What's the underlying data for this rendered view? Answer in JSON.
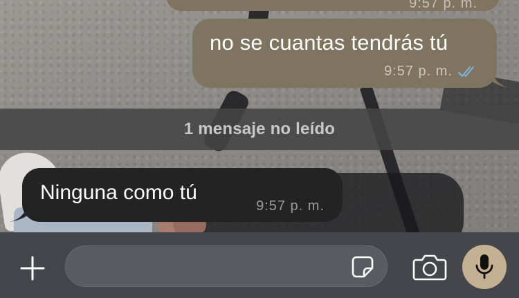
{
  "chat": {
    "previous_message": {
      "time": "9:57 p. m."
    },
    "outgoing_message": {
      "text": "no se cuantas tendrás tú",
      "time": "9:57 p. m.",
      "status_icon": "double-check-read-icon"
    },
    "unread_divider": {
      "label": "1 mensaje no leído"
    },
    "incoming_message": {
      "text": "Ninguna como tú",
      "time": "9:57 p. m."
    }
  },
  "composer": {
    "placeholder": "",
    "icons": [
      "plus-icon",
      "sticker-icon",
      "camera-icon",
      "microphone-icon"
    ]
  },
  "colors": {
    "outgoing_bubble": "#7f7460",
    "incoming_bubble": "#232323",
    "read_ticks": "#7fb6e6",
    "mic_button": "#c4b093",
    "composer_bar": "#45464b"
  }
}
